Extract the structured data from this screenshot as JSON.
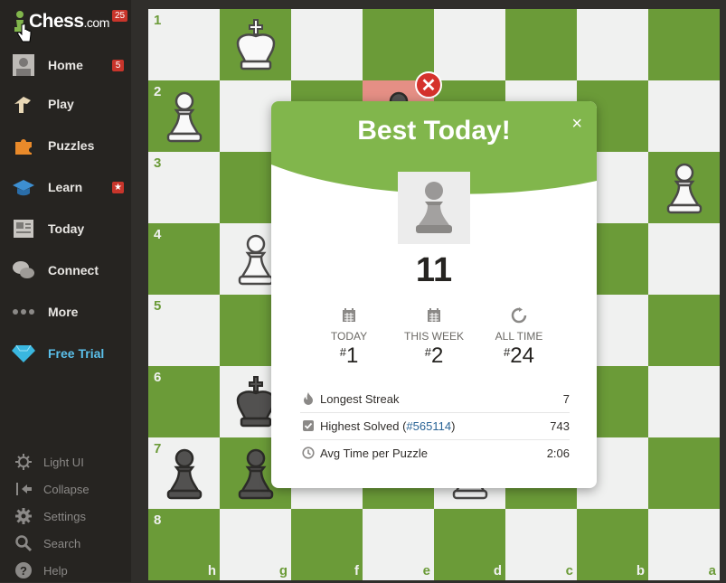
{
  "sidebar": {
    "logo_text": "Chess",
    "logo_suffix": ".com",
    "logo_badge": "25",
    "nav": [
      {
        "label": "Home",
        "icon": "home-avatar-icon",
        "badge": "5"
      },
      {
        "label": "Play",
        "icon": "play-icon",
        "badge": ""
      },
      {
        "label": "Puzzles",
        "icon": "puzzle-icon",
        "badge": ""
      },
      {
        "label": "Learn",
        "icon": "graduation-cap-icon",
        "badge": "★"
      },
      {
        "label": "Today",
        "icon": "newspaper-icon",
        "badge": ""
      },
      {
        "label": "Connect",
        "icon": "chat-bubbles-icon",
        "badge": ""
      },
      {
        "label": "More",
        "icon": "more-dots-icon",
        "badge": ""
      },
      {
        "label": "Free Trial",
        "icon": "diamond-icon",
        "badge": ""
      }
    ],
    "footer": [
      {
        "label": "Light UI",
        "icon": "sun-icon"
      },
      {
        "label": "Collapse",
        "icon": "collapse-icon"
      },
      {
        "label": "Settings",
        "icon": "gear-icon"
      },
      {
        "label": "Search",
        "icon": "search-icon"
      },
      {
        "label": "Help",
        "icon": "help-icon"
      }
    ]
  },
  "board": {
    "ranks": [
      "1",
      "2",
      "3",
      "4",
      "5",
      "6",
      "7",
      "8"
    ],
    "files": [
      "h",
      "g",
      "f",
      "e",
      "d",
      "c",
      "b",
      "a"
    ],
    "colors": {
      "light": "#f0f1f0",
      "dark": "#6b9b38",
      "highlight": "#e58f85"
    }
  },
  "modal": {
    "title": "Best Today!",
    "close": "×",
    "score": "11",
    "ranks": [
      {
        "label": "TODAY",
        "hash": "#",
        "value": "1"
      },
      {
        "label": "THIS WEEK",
        "hash": "#",
        "value": "2"
      },
      {
        "label": "ALL TIME",
        "hash": "#",
        "value": "24"
      }
    ],
    "stats": {
      "streak_label": "Longest Streak",
      "streak_value": "7",
      "highest_label": "Highest Solved",
      "highest_link": "#565114",
      "highest_value": "743",
      "avg_label": "Avg Time per Puzzle",
      "avg_value": "2:06"
    },
    "colors": {
      "header": "#81b64c"
    }
  }
}
